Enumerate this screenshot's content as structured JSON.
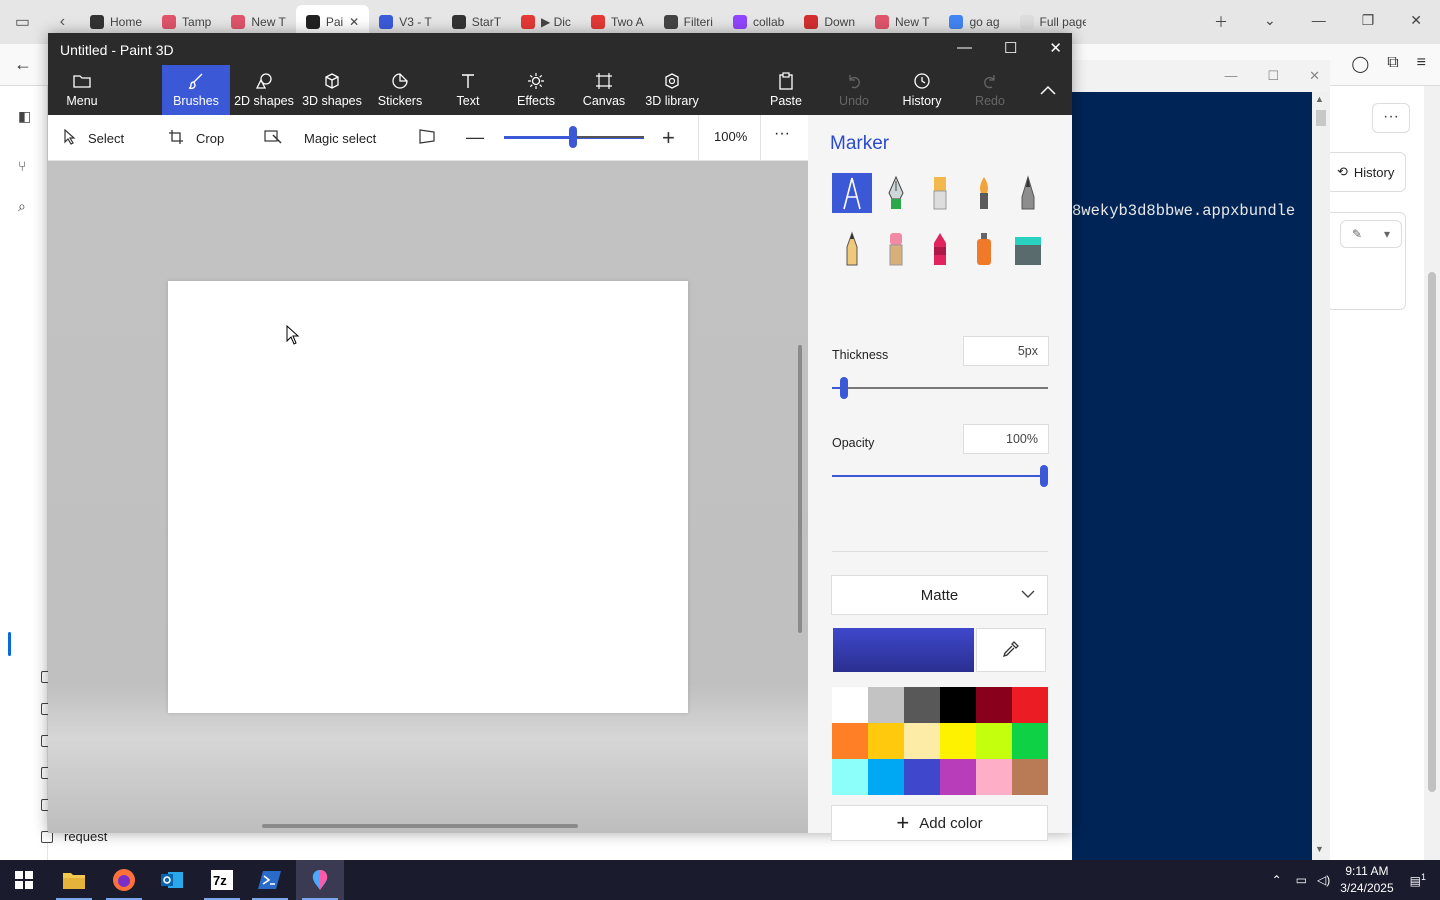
{
  "browser": {
    "tabs": [
      {
        "label": "Home",
        "color": "#333333"
      },
      {
        "label": "Tamp",
        "color": "#e0556b"
      },
      {
        "label": "New T",
        "color": "#e0556b"
      },
      {
        "label": "Pai",
        "color": "#222222",
        "active": true
      },
      {
        "label": "V3 - T",
        "color": "#3b5bdb"
      },
      {
        "label": "StarT",
        "color": "#333333"
      },
      {
        "label": "▶ Dic",
        "color": "#e53935"
      },
      {
        "label": "Two A",
        "color": "#e53935"
      },
      {
        "label": "Filteri",
        "color": "#444444"
      },
      {
        "label": "collab",
        "color": "#9146ff"
      },
      {
        "label": "Down",
        "color": "#d32f2f"
      },
      {
        "label": "New T",
        "color": "#e0556b"
      },
      {
        "label": "go ag",
        "color": "#4285f4"
      },
      {
        "label": "Full page",
        "color": "#dddddd"
      }
    ],
    "history_label": "History",
    "request_label": "request"
  },
  "terminal": {
    "output": "8wekyb3d8bbwe.appxbundle"
  },
  "paint3d": {
    "title": "Untitled - Paint 3D",
    "ribbon": {
      "menu": "Menu",
      "brushes": "Brushes",
      "shapes2d": "2D shapes",
      "shapes3d": "3D shapes",
      "stickers": "Stickers",
      "text": "Text",
      "effects": "Effects",
      "canvas": "Canvas",
      "library3d": "3D library",
      "paste": "Paste",
      "undo": "Undo",
      "history": "History",
      "redo": "Redo"
    },
    "toolbar": {
      "select": "Select",
      "crop": "Crop",
      "magic_select": "Magic select",
      "zoom": "100%",
      "more": "···"
    },
    "sidebar": {
      "title": "Marker",
      "thickness_label": "Thickness",
      "thickness_value": "5px",
      "opacity_label": "Opacity",
      "opacity_value": "100%",
      "finish": "Matte",
      "current_color": "#3f48cc",
      "add_color": "Add color",
      "palette": [
        "#ffffff",
        "#c3c3c3",
        "#585858",
        "#000000",
        "#88001b",
        "#ec1c24",
        "#ff7f27",
        "#ffc90e",
        "#fdeca6",
        "#fff200",
        "#c4ff0e",
        "#0ed145",
        "#8cfffb",
        "#00a8f3",
        "#3f48cc",
        "#b83dba",
        "#ffaec8",
        "#b97a56"
      ]
    }
  },
  "taskbar": {
    "time": "9:11 AM",
    "date": "3/24/2025",
    "notification_count": "1"
  }
}
